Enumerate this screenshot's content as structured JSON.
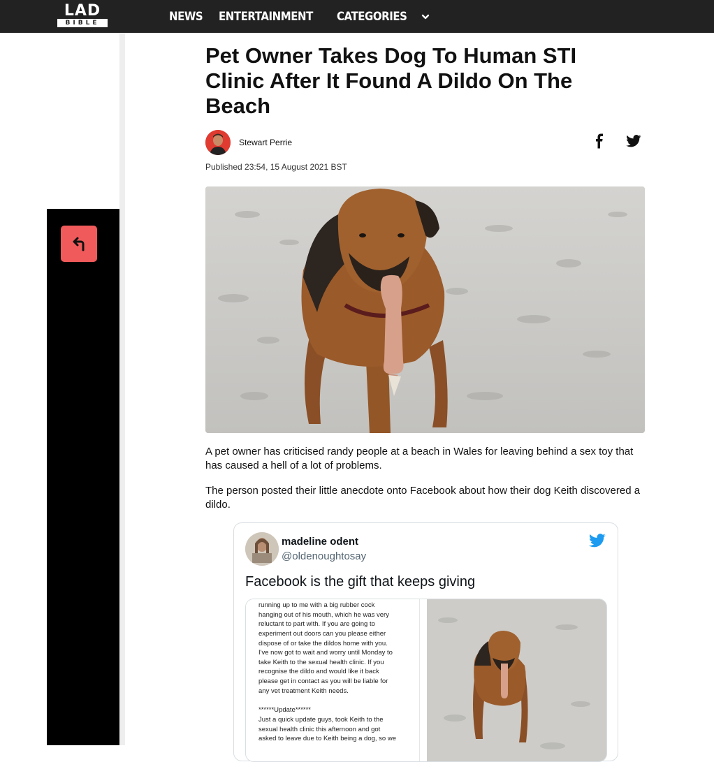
{
  "header": {
    "logo_top": "LAD",
    "logo_bottom": "BIBLE",
    "nav": [
      "NEWS",
      "ENTERTAINMENT",
      "CATEGORIES"
    ]
  },
  "article": {
    "headline": "Pet Owner Takes Dog To Human STI Clinic After It Found A Dildo On The Beach",
    "author": "Stewart Perrie",
    "published": "Published 23:54, 15 August 2021 BST",
    "paragraphs": [
      "A pet owner has criticised randy people at a beach in Wales for leaving behind a sex toy that has caused a hell of a lot of problems.",
      "The person posted their little anecdote onto Facebook about how their dog Keith discovered a dildo."
    ]
  },
  "tweet": {
    "name": "madeline odent",
    "handle": "@oldenoughtosay",
    "text": "Facebook is the gift that keeps giving",
    "screenshot_lines": [
      "running up to me with a big rubber cock",
      "hanging out of his mouth, which he was very",
      "reluctant to part with. If you are going to",
      "experiment out doors can you please either",
      "dispose of or take the dildos home with you.",
      "I've now got to wait and worry until Monday to",
      "take Keith to the sexual health clinic. If  you",
      "recognise the dildo and would like it back",
      "please get in contact as you will be liable for",
      "any vet treatment Keith needs.",
      "",
      "            ******Update******",
      "Just a quick update guys, took Keith to the",
      "sexual health clinic this afternoon and got",
      "asked to leave due to Keith being a dog, so we"
    ]
  },
  "colors": {
    "topbar": "#222222",
    "back_button": "#f05a5a",
    "twitter_blue": "#1d9bf0",
    "author_avatar": "#e03b30"
  },
  "icons": {
    "back": "arrow-turn-up-left-icon",
    "facebook": "facebook-icon",
    "twitter": "twitter-icon",
    "categories": "chevron-down-icon"
  }
}
